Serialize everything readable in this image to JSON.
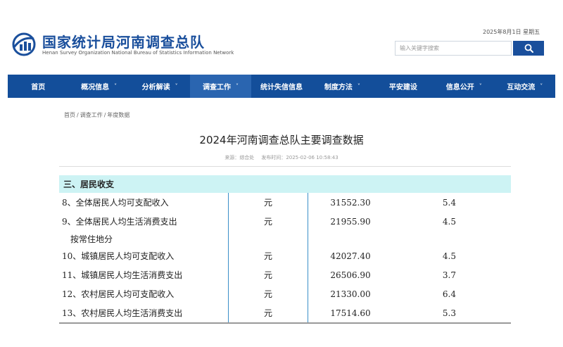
{
  "header": {
    "title": "国家统计局河南调查总队",
    "subtitle": "Henan Survey Organization National Bureau of Statistics Information Network",
    "date": "2025年8月1日 星期五",
    "search_placeholder": "输入关键字搜索"
  },
  "nav": {
    "items": [
      {
        "label": "首页",
        "caret": false
      },
      {
        "label": "概况信息",
        "caret": true
      },
      {
        "label": "分析解读",
        "caret": true
      },
      {
        "label": "调查工作",
        "caret": true,
        "active": true
      },
      {
        "label": "统计失信信息",
        "caret": false
      },
      {
        "label": "制度方法",
        "caret": true
      },
      {
        "label": "平安建设",
        "caret": false
      },
      {
        "label": "信息公开",
        "caret": true
      },
      {
        "label": "互动交流",
        "caret": true
      }
    ],
    "caret_glyph": "˅"
  },
  "breadcrumb": {
    "items": [
      "首页",
      "调查工作",
      "年度数据"
    ],
    "separator": "/"
  },
  "article": {
    "title": "2024年河南调查总队主要调查数据",
    "source_label": "来源：",
    "source": "综合处",
    "time_label": "发布时间：",
    "time": "2025-02-06 10:58:43"
  },
  "table": {
    "section": "三、居民收支",
    "rows": [
      {
        "name": "8、全体居民人均可支配收入",
        "unit": "元",
        "value": "31552.30",
        "growth": "5.4"
      },
      {
        "name": "9、全体居民人均生活消费支出",
        "unit": "元",
        "value": "21955.90",
        "growth": "4.5"
      },
      {
        "name": "按常住地分",
        "unit": "",
        "value": "",
        "growth": ""
      },
      {
        "name": "10、城镇居民人均可支配收入",
        "unit": "元",
        "value": "42027.40",
        "growth": "4.5"
      },
      {
        "name": "11、城镇居民人均生活消费支出",
        "unit": "元",
        "value": "26506.90",
        "growth": "3.7"
      },
      {
        "name": "12、农村居民人均可支配收入",
        "unit": "元",
        "value": "21330.00",
        "growth": "6.4"
      },
      {
        "name": "13、农村居民人均生活消费支出",
        "unit": "元",
        "value": "17514.60",
        "growth": "5.3"
      }
    ]
  },
  "colors": {
    "brand_blue": "#1a4f9c",
    "nav_bg": "#134e9a",
    "nav_active": "#2a65b0",
    "section_bg": "#cdf3f4",
    "column_rule": "#3a8fc8"
  },
  "icons": {
    "logo": "nbs-logo-icon",
    "search": "search-icon"
  }
}
